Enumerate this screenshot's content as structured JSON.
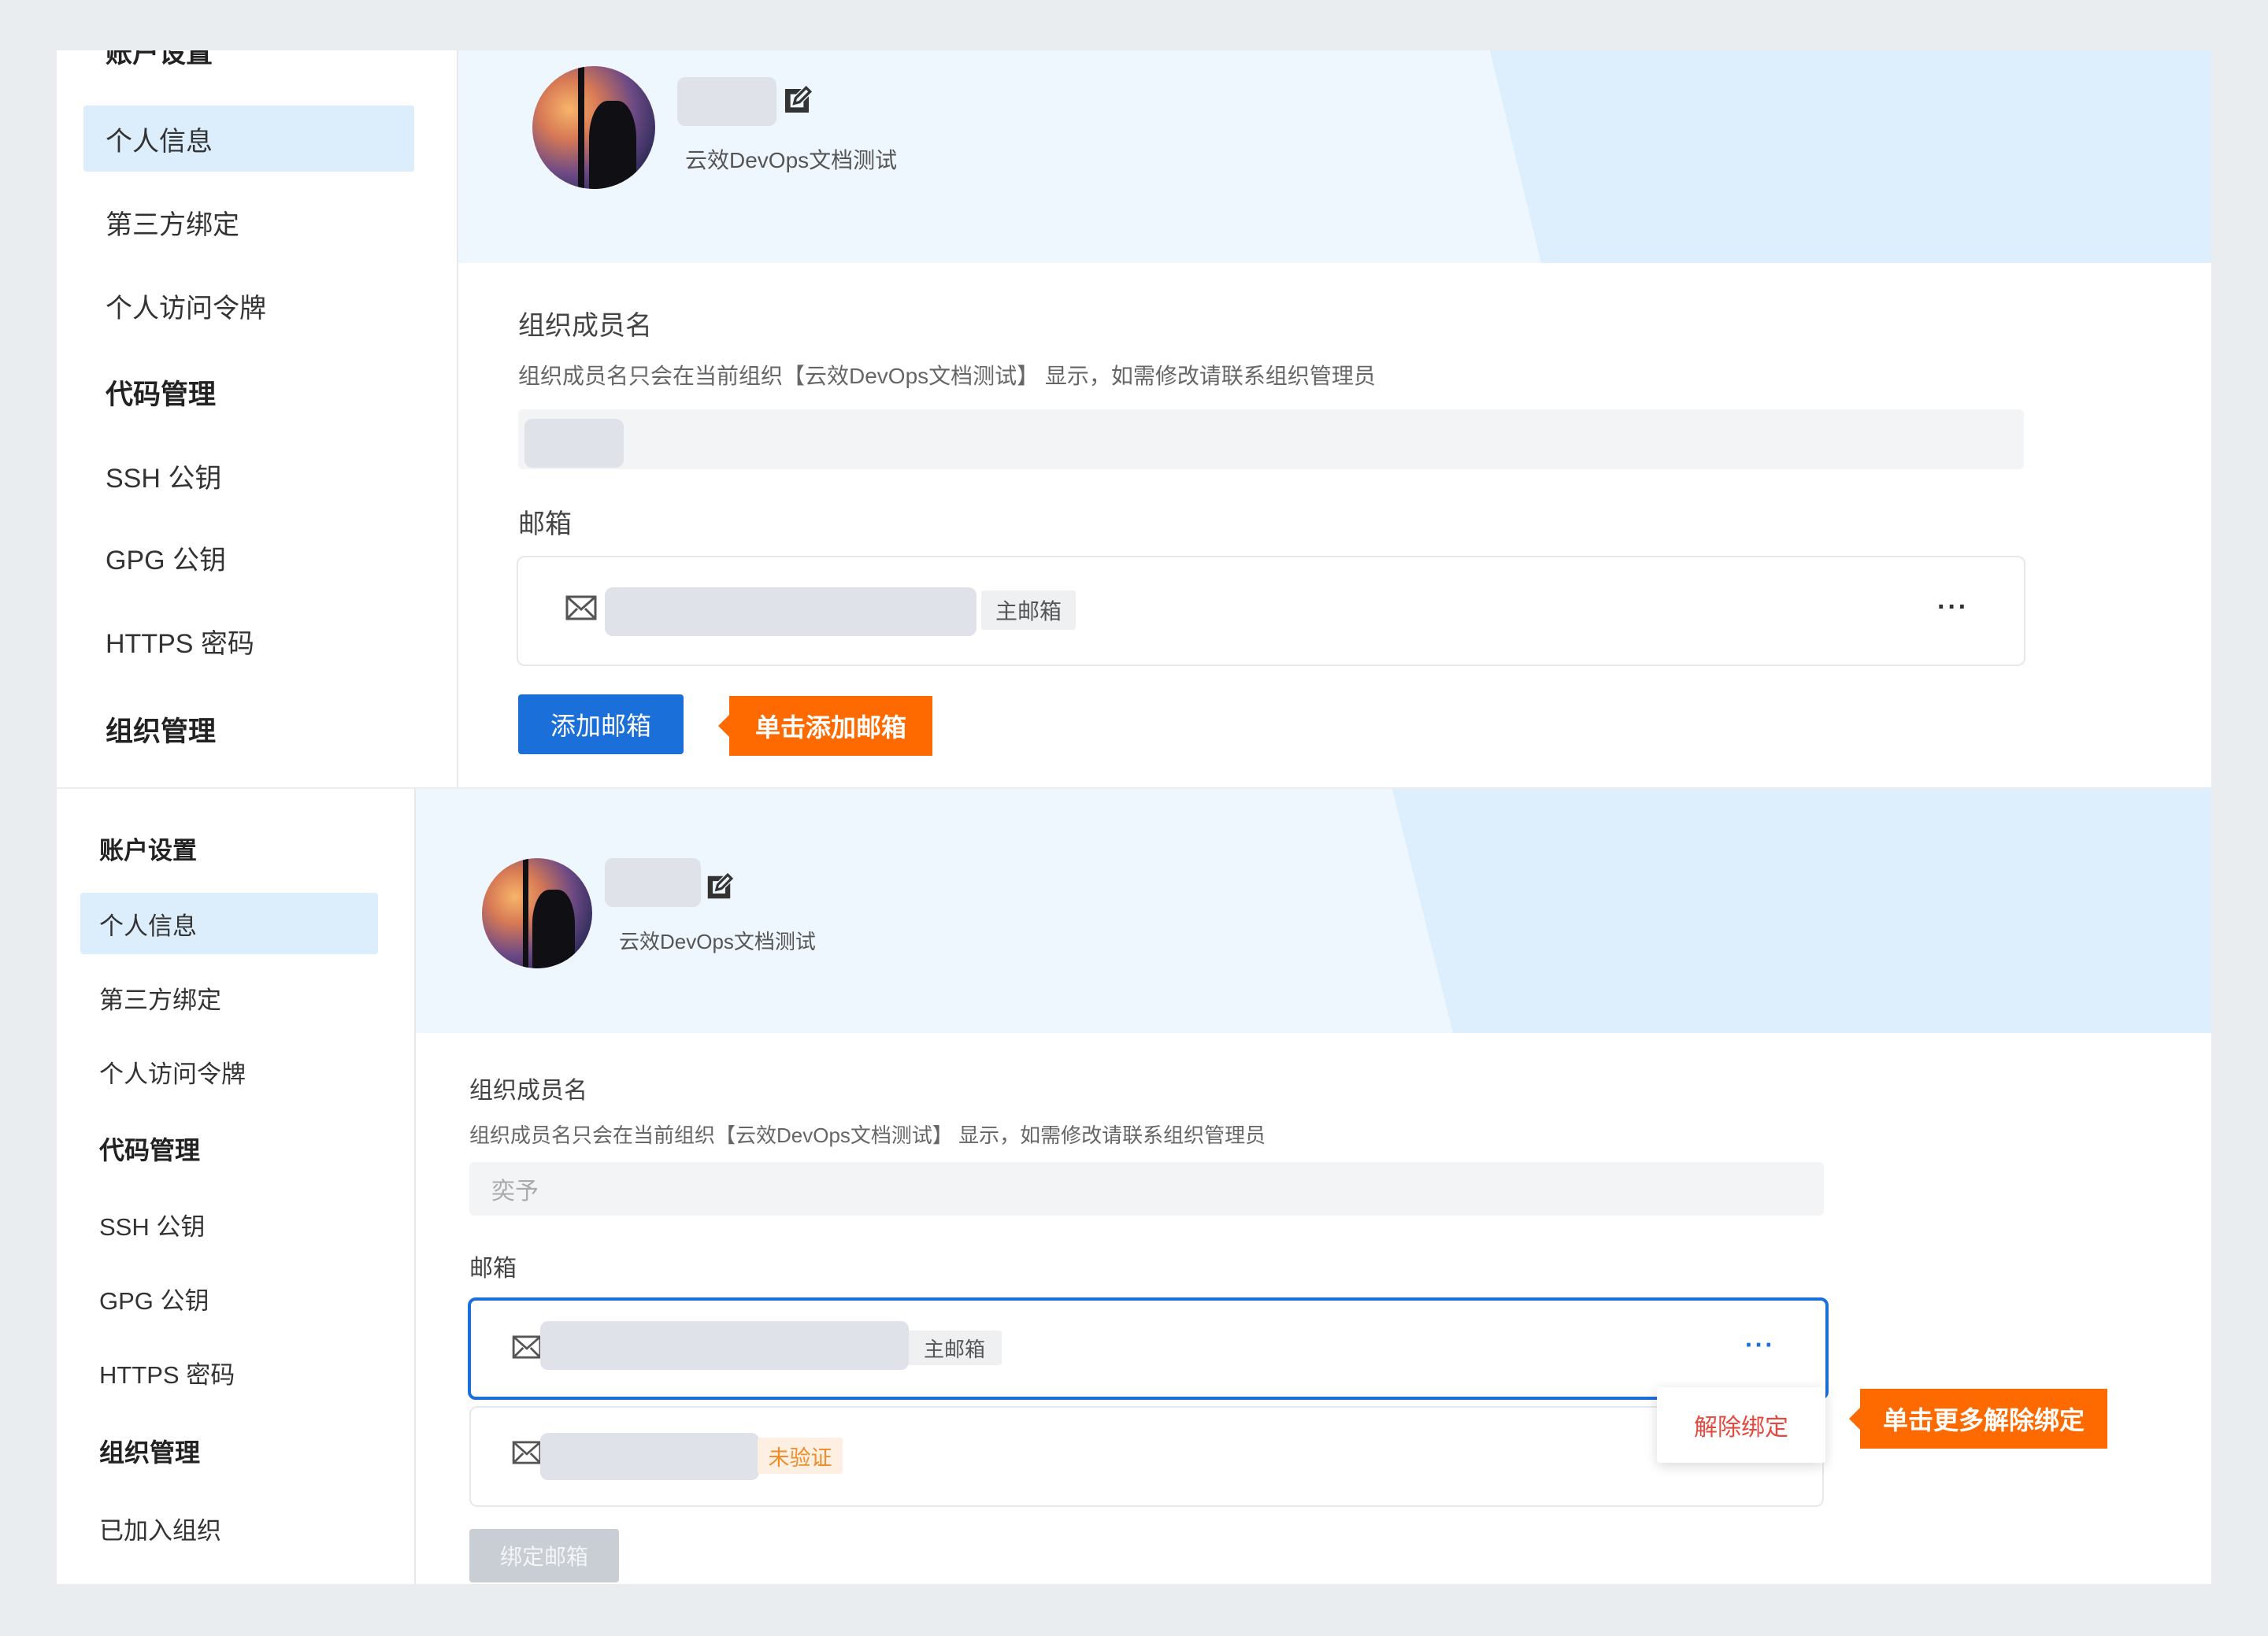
{
  "top": {
    "sidebar": {
      "cut_label": "账户设置",
      "items": [
        {
          "label": "个人信息"
        },
        {
          "label": "第三方绑定"
        },
        {
          "label": "个人访问令牌"
        },
        {
          "label": "代码管理"
        },
        {
          "label": "SSH 公钥"
        },
        {
          "label": "GPG 公钥"
        },
        {
          "label": "HTTPS 密码"
        },
        {
          "label": "组织管理"
        }
      ]
    },
    "profile": {
      "org_name": "云效DevOps文档测试"
    },
    "member_name": {
      "label": "组织成员名",
      "hint": "组织成员名只会在当前组织【云效DevOps文档测试】 显示，如需修改请联系组织管理员"
    },
    "email": {
      "label": "邮箱",
      "primary_tag": "主邮箱",
      "more": "···",
      "add_button": "添加邮箱"
    },
    "callout": "单击添加邮箱"
  },
  "bottom": {
    "sidebar": {
      "title": "账户设置",
      "items": [
        {
          "label": "个人信息"
        },
        {
          "label": "第三方绑定"
        },
        {
          "label": "个人访问令牌"
        },
        {
          "label": "代码管理"
        },
        {
          "label": "SSH 公钥"
        },
        {
          "label": "GPG 公钥"
        },
        {
          "label": "HTTPS 密码"
        },
        {
          "label": "组织管理"
        },
        {
          "label": "已加入组织"
        }
      ]
    },
    "profile": {
      "org_name": "云效DevOps文档测试"
    },
    "member_name": {
      "label": "组织成员名",
      "hint": "组织成员名只会在当前组织【云效DevOps文档测试】 显示，如需修改请联系组织管理员",
      "value": "奕予"
    },
    "email": {
      "label": "邮箱",
      "primary_tag": "主邮箱",
      "unverified_tag": "未验证",
      "more": "···",
      "bind_button": "绑定邮箱",
      "dropdown_item": "解除绑定"
    },
    "callout": "单击更多解除绑定"
  },
  "colors": {
    "primary": "#1a6fd8",
    "callout": "#fe6a00",
    "danger": "#e5483f",
    "warning": "#f08c2a",
    "band": "#eef6fe",
    "active_item": "#dcedfc"
  }
}
